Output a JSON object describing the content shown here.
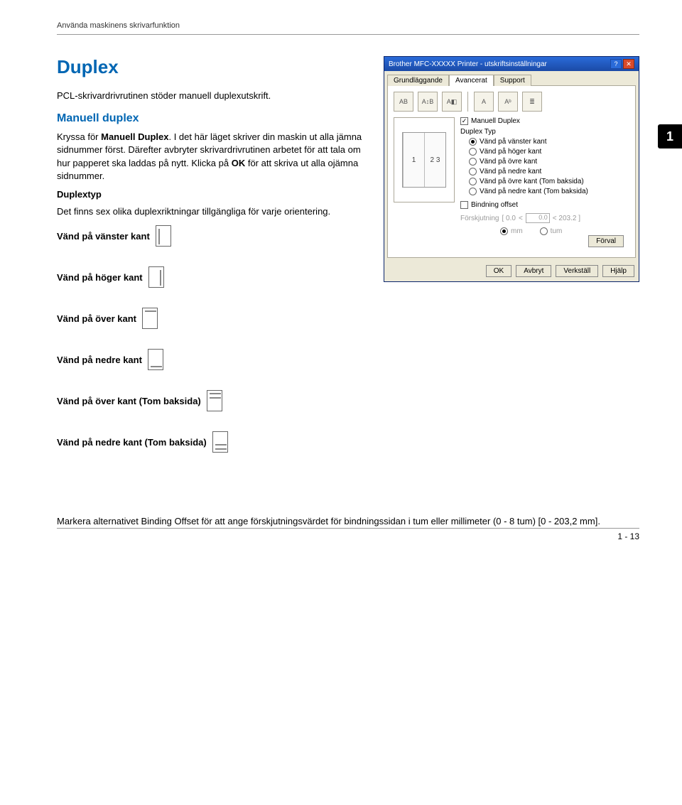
{
  "header": "Använda maskinens skrivarfunktion",
  "chapter_number": "1",
  "title": "Duplex",
  "intro": "PCL-skrivardrivrutinen stöder manuell duplexutskrift.",
  "manual_duplex_heading": "Manuell duplex",
  "manual_duplex_p1_a": "Kryssa för ",
  "manual_duplex_p1_b": "Manuell Duplex",
  "manual_duplex_p1_c": ". I det här läget skriver din maskin ut alla jämna sidnummer först. Därefter avbryter skrivardrivrutinen arbetet för att tala om hur papperet ska laddas på nytt. Klicka på ",
  "manual_duplex_p1_d": "OK",
  "manual_duplex_p1_e": " för att skriva ut alla ojämna sidnummer.",
  "duplextyp_heading": "Duplextyp",
  "duplextyp_text": "Det finns sex olika duplexriktningar tillgängliga för varje orientering.",
  "options": [
    "Vänd på vänster kant",
    "Vänd på höger kant",
    "Vänd på över kant",
    "Vänd på nedre kant",
    "Vänd på över kant (Tom baksida)",
    "Vänd på nedre kant (Tom baksida)"
  ],
  "footer_text": "Markera alternativet Binding Offset för att ange förskjutningsvärdet för bindningssidan i tum eller millimeter (0 - 8 tum) [0 - 203,2 mm].",
  "page_number": "1 - 13",
  "dialog": {
    "title": "Brother MFC-XXXXX Printer - utskriftsinställningar",
    "tabs": {
      "basic": "Grundläggande",
      "advanced": "Avancerat",
      "support": "Support"
    },
    "strip_icons": [
      "AB",
      "A↕B",
      "A◧",
      "A",
      "Aᵇ",
      "≣"
    ],
    "manual_duplex": "Manuell Duplex",
    "duplex_typ": "Duplex Typ",
    "radios": [
      "Vänd på vänster kant",
      "Vänd på höger kant",
      "Vänd på övre kant",
      "Vänd på nedre kant",
      "Vänd på övre kant (Tom baksida)",
      "Vänd på nedre kant (Tom baksida)"
    ],
    "binding_offset": "Bindning offset",
    "forskjutning": "Förskjutning",
    "range_a": "[ 0.0",
    "range_b": "< 203.2 ]",
    "value": "0.0",
    "unit_mm": "mm",
    "unit_tum": "tum",
    "preview_nums": {
      "a": "1",
      "b": "2",
      "c": "3"
    },
    "buttons": {
      "ok": "OK",
      "cancel": "Avbryt",
      "apply": "Verkställ",
      "help": "Hjälp",
      "default": "Förval"
    }
  }
}
